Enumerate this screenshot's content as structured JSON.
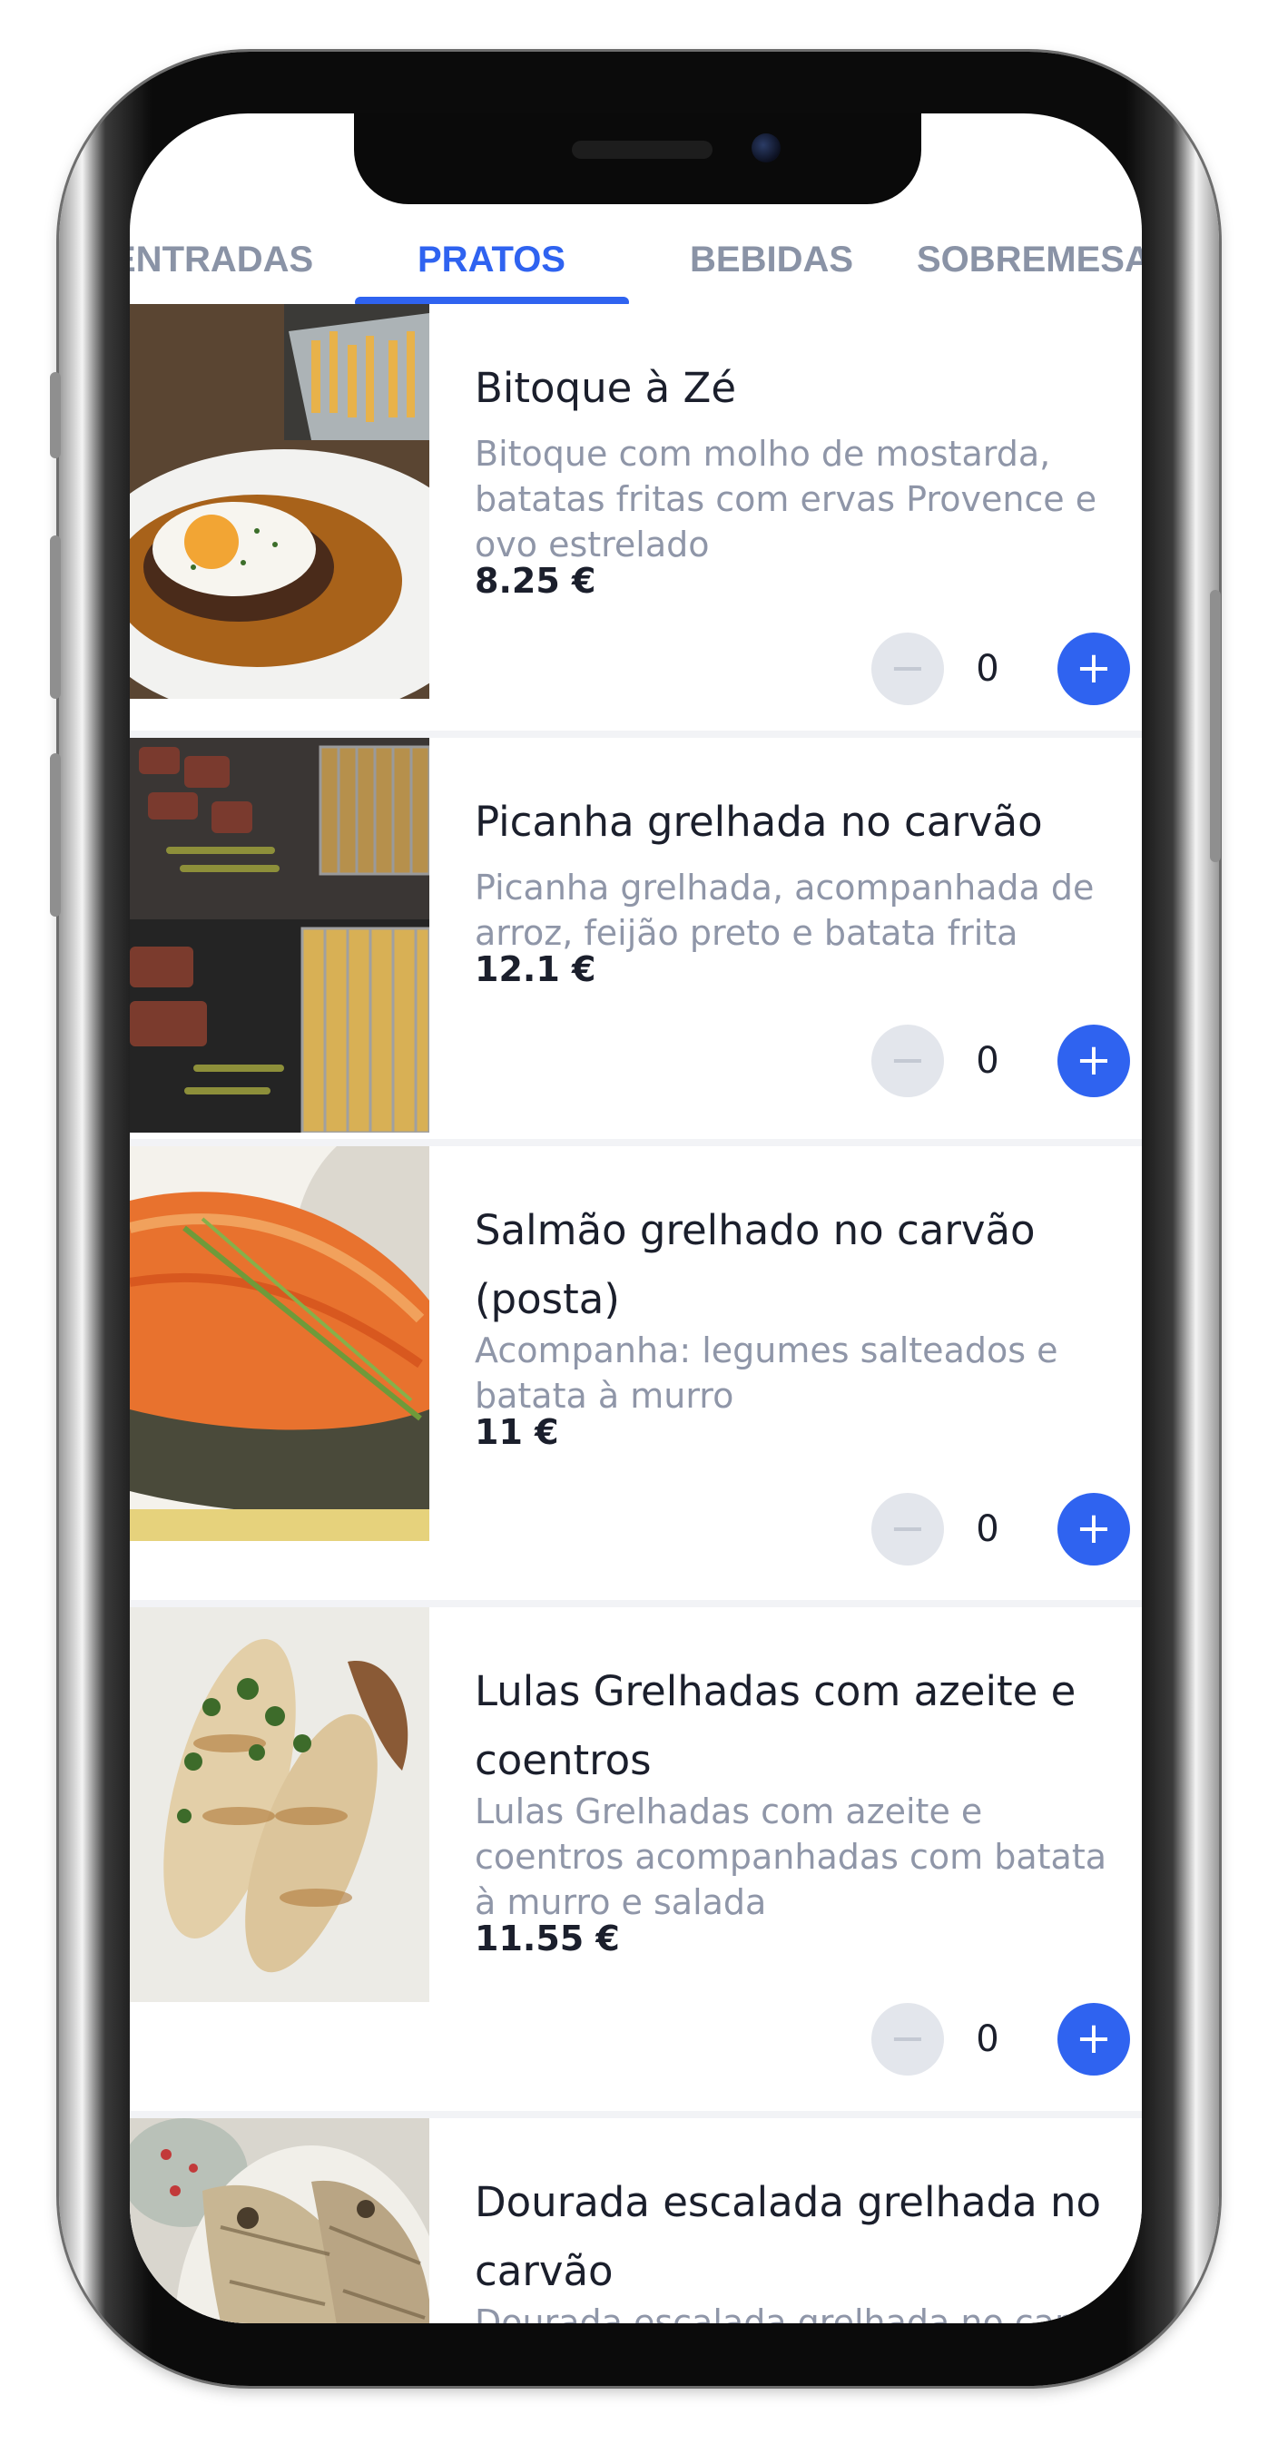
{
  "tabs": [
    {
      "label": "ENTRADAS"
    },
    {
      "label": "PRATOS"
    },
    {
      "label": "BEBIDAS"
    },
    {
      "label": "SOBREMESAS"
    }
  ],
  "active_tab": "PRATOS",
  "colors": {
    "accent": "#2f63f0",
    "muted_text": "#8f96a8",
    "tab_inactive": "#8a93a6"
  },
  "items": [
    {
      "name": "Bitoque à Zé",
      "description": "Bitoque com molho de mostarda, batatas fritas com ervas Provence e ovo estrelado",
      "price": "8.25 €",
      "quantity": "0",
      "minus_label": "−",
      "plus_label": "+"
    },
    {
      "name": "Picanha grelhada no carvão",
      "description": "Picanha grelhada, acompanhada de arroz, feijão preto e batata frita",
      "price": "12.1 €",
      "quantity": "0",
      "minus_label": "−",
      "plus_label": "+"
    },
    {
      "name": "Salmão grelhado no carvão (posta)",
      "description": "Acompanha: legumes salteados e batata à murro",
      "price": "11 €",
      "quantity": "0",
      "minus_label": "−",
      "plus_label": "+"
    },
    {
      "name": "Lulas Grelhadas com azeite e coentros",
      "description": "Lulas Grelhadas com azeite e coentros acompanhadas com batata à murro e salada",
      "price": "11.55 €",
      "quantity": "0",
      "minus_label": "−",
      "plus_label": "+"
    },
    {
      "name": "Dourada escalada grelhada no carvão",
      "description": "Dourada escalada grelhada no carvão"
    }
  ]
}
